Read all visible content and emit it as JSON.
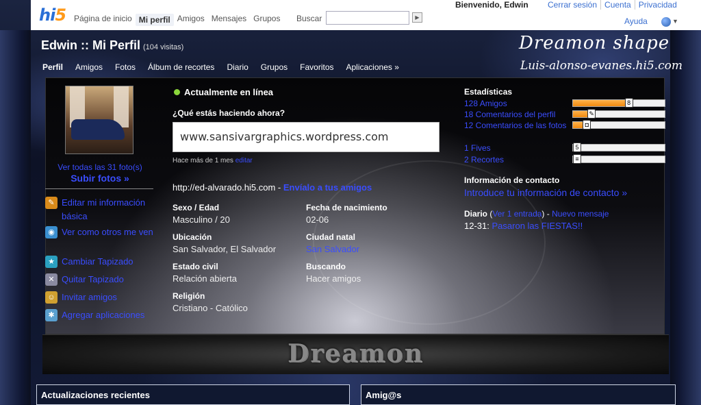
{
  "topbar": {
    "logo_hi": "hi",
    "logo_five": "5",
    "nav": [
      "Página de inicio",
      "Mi perfil",
      "Amigos",
      "Mensajes",
      "Grupos"
    ],
    "search_label": "Buscar",
    "search_button": "▶",
    "welcome": "Bienvenido, Edwin",
    "links": [
      "Cerrar sesión",
      "Cuenta",
      "Privacidad"
    ],
    "help": "Ayuda",
    "globe_caret": "▼"
  },
  "profile": {
    "title": "Edwin :: Mi Perfil",
    "visits": "(104 visitas)",
    "banner": "Dreamon shape",
    "banner_sub": "Luis-alonso-evanes.hi5.com",
    "nav": [
      "Perfil",
      "Amigos",
      "Fotos",
      "Álbum de recortes",
      "Diario",
      "Grupos",
      "Favoritos",
      "Aplicaciones »"
    ]
  },
  "left": {
    "photos_link": "Ver todas las 31 foto(s)",
    "upload_link": "Subir fotos »",
    "actions": [
      {
        "label": "Editar mi información básica",
        "icon": "pencil-icon",
        "glyph": "✎",
        "color": "#d98a1a"
      },
      {
        "label": "Ver como otros me ven",
        "icon": "eye-icon",
        "glyph": "◉",
        "color": "#3a8fd0"
      },
      {
        "label": "Cambiar Tapizado",
        "icon": "star-icon",
        "glyph": "★",
        "color": "#2aa0c0"
      },
      {
        "label": "Quitar Tapizado",
        "icon": "remove-icon",
        "glyph": "✕",
        "color": "#8a8aa0"
      },
      {
        "label": "Invitar amigos",
        "icon": "invite-icon",
        "glyph": "☺",
        "color": "#d0a030"
      },
      {
        "label": "Agregar aplicaciones",
        "icon": "apps-icon",
        "glyph": "✱",
        "color": "#5aa0d0"
      }
    ]
  },
  "center": {
    "online": "Actualmente en línea",
    "status_question": "¿Qué estás haciendo ahora?",
    "status_value": "www.sansivargraphics.wordpress.com",
    "status_time": "Hace más de 1 mes",
    "status_edit": "editar",
    "url": "http://ed-alvarado.hi5.com",
    "url_sep": " - ",
    "send_friends": "Envíalo a tus amigos",
    "fields": [
      {
        "label": "Sexo / Edad",
        "value": "Masculino /  20"
      },
      {
        "label": "Fecha de nacimiento",
        "value": "02-06"
      },
      {
        "label": "Ubicación",
        "value": "San Salvador, El Salvador"
      },
      {
        "label": "Ciudad natal",
        "value": "San Salvador",
        "link": true
      },
      {
        "label": "Estado civil",
        "value": "Relación abierta"
      },
      {
        "label": "Buscando",
        "value": "Hacer amigos"
      },
      {
        "label": "Religión",
        "value": "Cristiano - Católico"
      }
    ]
  },
  "right": {
    "stats_title": "Estadísticas",
    "stats": [
      {
        "label": "128 Amigos",
        "fill": 0.6,
        "marker": "8"
      },
      {
        "label": "18 Comentarios del perfil",
        "fill": 0.2,
        "marker": "✎"
      },
      {
        "label": "12 Comentarios de las fotos",
        "fill": 0.15,
        "marker": "◘"
      },
      {
        "label": "1 Fives",
        "fill": 0.02,
        "marker": "5"
      },
      {
        "label": "2 Recortes",
        "fill": 0.03,
        "marker": "≡"
      }
    ],
    "contact_title": "Información de contacto",
    "contact_link": "Introduce tu información de contacto »",
    "diary_label": "Diario",
    "diary_open": " (",
    "diary_entries_link": "Ver 1 entrada",
    "diary_close": ") - ",
    "diary_new": "Nuevo mensaje",
    "diary_entry_date": "12-31:",
    "diary_entry_title": "Pasaron las FIESTAS!!"
  },
  "band": {
    "text": "Dreamon"
  },
  "bottom": {
    "left_title": "Actualizaciones recientes",
    "right_title": "Amig@s"
  }
}
